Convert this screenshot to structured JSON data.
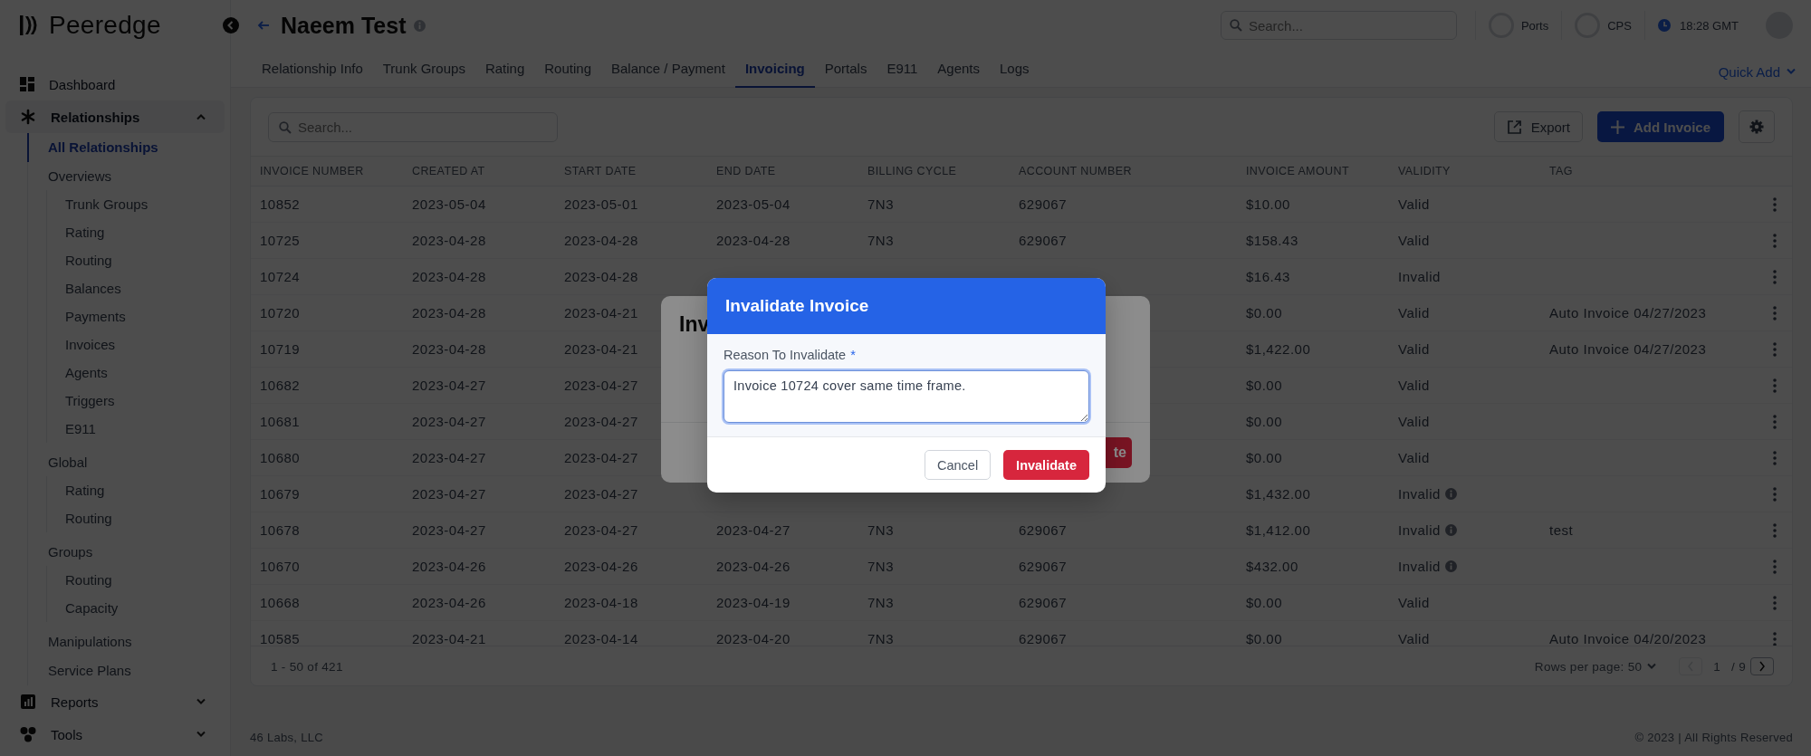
{
  "brand": {
    "name": "Peeredge"
  },
  "sidebar": {
    "items": [
      {
        "label": "Dashboard"
      },
      {
        "label": "Relationships",
        "expanded": true,
        "children": [
          {
            "label": "All Relationships",
            "selected": true
          },
          {
            "label": "Overviews",
            "selected": false,
            "children": [
              {
                "label": "Trunk Groups",
                "selected": false
              },
              {
                "label": "Rating",
                "selected": false
              },
              {
                "label": "Routing",
                "selected": false
              },
              {
                "label": "Balances",
                "selected": false
              },
              {
                "label": "Payments",
                "selected": false
              },
              {
                "label": "Invoices",
                "selected": false
              },
              {
                "label": "Agents",
                "selected": false
              },
              {
                "label": "Triggers",
                "selected": false
              },
              {
                "label": "E911",
                "selected": false
              }
            ]
          },
          {
            "label": "Global",
            "selected": false,
            "children": [
              {
                "label": "Rating",
                "selected": false
              },
              {
                "label": "Routing",
                "selected": false
              }
            ]
          },
          {
            "label": "Groups",
            "selected": false,
            "children": [
              {
                "label": "Routing",
                "selected": false
              },
              {
                "label": "Capacity",
                "selected": false
              }
            ]
          },
          {
            "label": "Manipulations",
            "selected": false
          },
          {
            "label": "Service Plans",
            "selected": false
          }
        ]
      },
      {
        "label": "Reports",
        "expanded": false
      },
      {
        "label": "Tools",
        "expanded": false
      }
    ]
  },
  "header": {
    "title": "Naeem Test",
    "search": {
      "placeholder": "Search..."
    },
    "meters": [
      {
        "label": "Ports"
      },
      {
        "label": "CPS"
      }
    ],
    "clock": "18:28 GMT"
  },
  "tabs": [
    {
      "label": "Relationship Info",
      "selected": false
    },
    {
      "label": "Trunk Groups",
      "selected": false
    },
    {
      "label": "Rating",
      "selected": false
    },
    {
      "label": "Routing",
      "selected": false
    },
    {
      "label": "Balance / Payment",
      "selected": false
    },
    {
      "label": "Invoicing",
      "selected": true
    },
    {
      "label": "Portals",
      "selected": false
    },
    {
      "label": "E911",
      "selected": false
    },
    {
      "label": "Agents",
      "selected": false
    },
    {
      "label": "Logs",
      "selected": false
    }
  ],
  "quick_add": "Quick Add",
  "table": {
    "search": {
      "placeholder": "Search..."
    },
    "export": "Export",
    "add": "Add Invoice",
    "columns": [
      "INVOICE NUMBER",
      "CREATED AT",
      "START DATE",
      "END DATE",
      "BILLING CYCLE",
      "ACCOUNT NUMBER",
      "INVOICE AMOUNT",
      "VALIDITY",
      "TAG"
    ],
    "rows": [
      {
        "cells": [
          "10852",
          "2023-05-04",
          "2023-05-01",
          "2023-05-04",
          "7N3",
          "629067",
          "$10.00",
          "Valid"
        ],
        "info": false
      },
      {
        "cells": [
          "10725",
          "2023-04-28",
          "2023-04-28",
          "2023-04-28",
          "7N3",
          "629067",
          "$158.43",
          "Valid"
        ],
        "info": false
      },
      {
        "cells": [
          "10724",
          "2023-04-28",
          "2023-04-28",
          null,
          null,
          null,
          "$16.43",
          "Invalid"
        ],
        "info": false
      },
      {
        "cells": [
          "10720",
          "2023-04-28",
          "2023-04-21",
          null,
          null,
          null,
          "$0.00",
          "Valid",
          "Auto Invoice 04/27/2023"
        ],
        "info": false
      },
      {
        "cells": [
          "10719",
          "2023-04-28",
          "2023-04-21",
          null,
          null,
          null,
          "$1,422.00",
          "Valid",
          "Auto Invoice 04/27/2023"
        ],
        "info": false
      },
      {
        "cells": [
          "10682",
          "2023-04-27",
          "2023-04-27",
          null,
          null,
          null,
          "$0.00",
          "Valid"
        ],
        "info": false
      },
      {
        "cells": [
          "10681",
          "2023-04-27",
          "2023-04-27",
          null,
          null,
          null,
          "$0.00",
          "Valid"
        ],
        "info": false
      },
      {
        "cells": [
          "10680",
          "2023-04-27",
          "2023-04-27",
          null,
          null,
          null,
          "$0.00",
          "Valid"
        ],
        "info": false
      },
      {
        "cells": [
          "10679",
          "2023-04-27",
          "2023-04-27",
          null,
          null,
          null,
          "$1,432.00",
          "Invalid"
        ],
        "info": true
      },
      {
        "cells": [
          "10678",
          "2023-04-27",
          "2023-04-27",
          "2023-04-27",
          "7N3",
          "629067",
          "$1,412.00",
          "Invalid",
          "test"
        ],
        "info": true
      },
      {
        "cells": [
          "10670",
          "2023-04-26",
          "2023-04-26",
          "2023-04-26",
          "7N3",
          "629067",
          "$432.00",
          "Invalid"
        ],
        "info": true
      },
      {
        "cells": [
          "10668",
          "2023-04-26",
          "2023-04-18",
          "2023-04-19",
          "7N3",
          "629067",
          "$0.00",
          "Valid"
        ],
        "info": false
      },
      {
        "cells": [
          "10585",
          "2023-04-21",
          "2023-04-14",
          "2023-04-20",
          "7N3",
          "629067",
          "$0.00",
          "Valid",
          "Auto Invoice 04/20/2023"
        ],
        "info": false
      }
    ],
    "pagination": {
      "range": "1 - 50 of 421",
      "rows_per_page": "Rows per page: 50",
      "page": "1",
      "total": "/ 9",
      "prev_disabled": true,
      "next_disabled": false
    }
  },
  "footer": {
    "company": "46 Labs, LLC",
    "copyright": "© 2023 | All Rights Reserved"
  },
  "back_dialog": {
    "title": "Inv",
    "button": "te"
  },
  "dialog": {
    "title": "Invalidate Invoice",
    "field": {
      "label": "Reason To Invalidate",
      "required_mark": "*",
      "value": "Invoice 10724 cover same time frame."
    },
    "buttons": [
      {
        "label": "Cancel",
        "kind": "secondary"
      },
      {
        "label": "Invalidate",
        "kind": "danger"
      }
    ]
  }
}
